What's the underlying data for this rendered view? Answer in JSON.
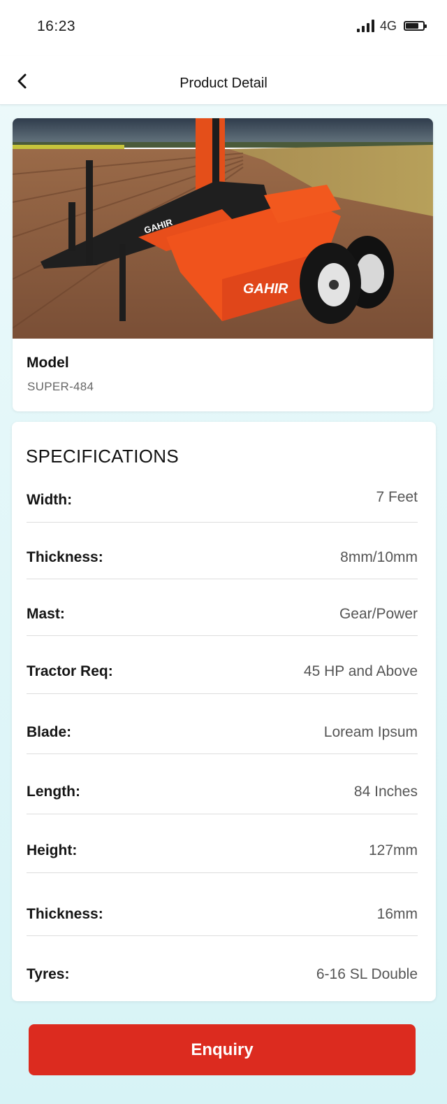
{
  "status_bar": {
    "time": "16:23",
    "network": "4G"
  },
  "header": {
    "title": "Product Detail",
    "back_icon": "chevron-left-icon"
  },
  "product": {
    "model_label": "Model",
    "model_value": "SUPER-484",
    "brand_text": "GAHIR"
  },
  "specifications": {
    "title": "SPECIFICATIONS",
    "rows": [
      {
        "label": "Width:",
        "value": "7 Feet"
      },
      {
        "label": "Thickness:",
        "value": "8mm/10mm"
      },
      {
        "label": "Mast:",
        "value": "Gear/Power"
      },
      {
        "label": "Tractor Req:",
        "value": "45 HP and Above"
      },
      {
        "label": "Blade:",
        "value": "Loream Ipsum"
      },
      {
        "label": "Length:",
        "value": "84 Inches"
      },
      {
        "label": "Height:",
        "value": "127mm"
      },
      {
        "label": "Thickness:",
        "value": "16mm"
      },
      {
        "label": "Tyres:",
        "value": "6-16 SL Double"
      }
    ]
  },
  "actions": {
    "enquiry_label": "Enquiry"
  },
  "colors": {
    "accent": "#dc2b1f",
    "machine_orange": "#f0531c",
    "background": "#e4f7f9"
  }
}
